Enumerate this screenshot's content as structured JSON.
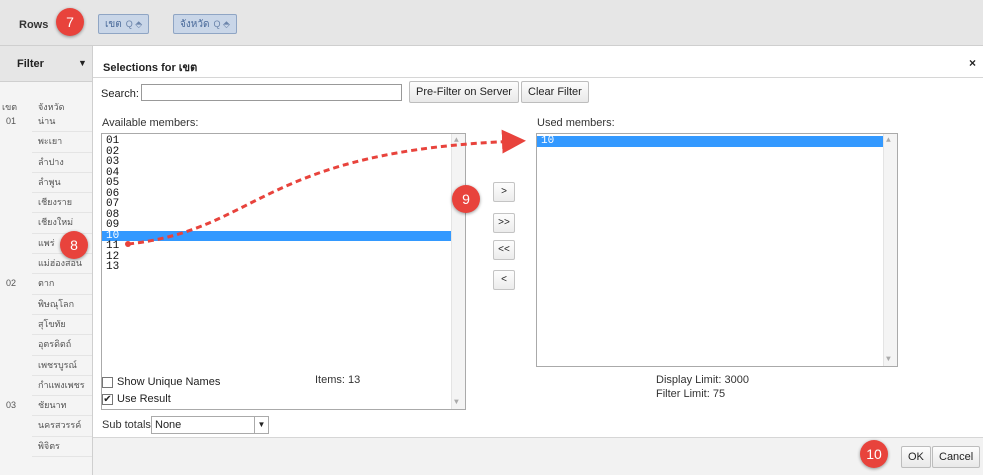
{
  "rows_bar": {
    "label": "Rows",
    "chips": [
      {
        "label": "เขต",
        "icons": "Q ⬘"
      },
      {
        "label": "จังหวัด",
        "icons": "Q ⬘"
      }
    ]
  },
  "filter": {
    "label": "Filter",
    "caret": "▼"
  },
  "left_grid": {
    "headers": [
      "เขต",
      "จังหวัด"
    ],
    "codes": [
      "01",
      "",
      "",
      "",
      "",
      "",
      "",
      "",
      "02",
      "",
      "",
      "",
      "",
      "",
      "03",
      "",
      "",
      ""
    ],
    "provinces": [
      "น่าน",
      "พะเยา",
      "ลำปาง",
      "ลำพูน",
      "เชียงราย",
      "เชียงใหม่",
      "แพร่",
      "แม่ฮ่องสอน",
      "ตาก",
      "พิษณุโลก",
      "สุโขทัย",
      "อุตรดิตถ์",
      "เพชรบูรณ์",
      "กำแพงเพชร",
      "ชัยนาท",
      "นครสวรรค์",
      "พิจิตร"
    ]
  },
  "dialog": {
    "title": "Selections for เขต",
    "close": "×",
    "search_label": "Search:",
    "search_value": "",
    "prefilter_button": "Pre-Filter on Server",
    "clear_filter_button": "Clear Filter",
    "available_label": "Available members:",
    "used_label": "Used members:",
    "available_members": [
      "01",
      "02",
      "03",
      "04",
      "05",
      "06",
      "07",
      "08",
      "09",
      "10",
      "11",
      "12",
      "13"
    ],
    "available_selected": "10",
    "used_members": [
      "10"
    ],
    "move_buttons": [
      ">",
      ">>",
      "<<",
      "<"
    ],
    "show_unique_names": "Show Unique Names",
    "show_unique_checked": false,
    "use_result": "Use Result",
    "use_result_checked": true,
    "items_text": "Items: 13",
    "display_limit": "Display Limit: 3000",
    "filter_limit": "Filter Limit: 75",
    "subtotals_label": "Sub totals",
    "subtotals_value": "None",
    "ok_button": "OK",
    "cancel_button": "Cancel"
  },
  "steps": [
    "7",
    "8",
    "9",
    "10"
  ],
  "colors": {
    "marker": "#e8433c",
    "selection": "#3399ff",
    "arrow": "#e8433c"
  }
}
